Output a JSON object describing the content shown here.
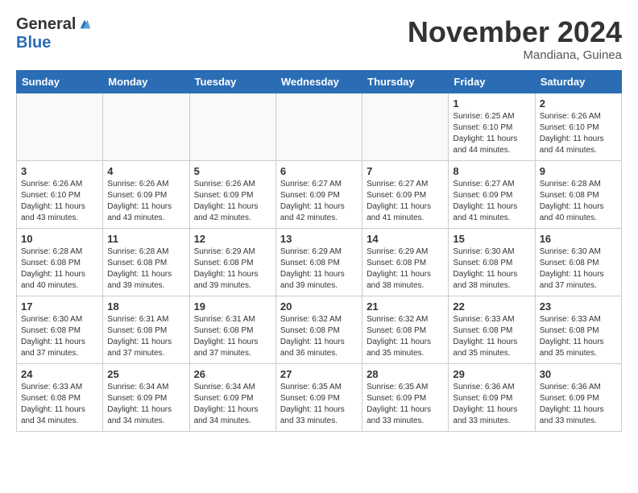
{
  "header": {
    "logo_general": "General",
    "logo_blue": "Blue",
    "month_title": "November 2024",
    "location": "Mandiana, Guinea"
  },
  "days_of_week": [
    "Sunday",
    "Monday",
    "Tuesday",
    "Wednesday",
    "Thursday",
    "Friday",
    "Saturday"
  ],
  "weeks": [
    [
      {
        "day": "",
        "sunrise": "",
        "sunset": "",
        "daylight": "",
        "empty": true
      },
      {
        "day": "",
        "sunrise": "",
        "sunset": "",
        "daylight": "",
        "empty": true
      },
      {
        "day": "",
        "sunrise": "",
        "sunset": "",
        "daylight": "",
        "empty": true
      },
      {
        "day": "",
        "sunrise": "",
        "sunset": "",
        "daylight": "",
        "empty": true
      },
      {
        "day": "",
        "sunrise": "",
        "sunset": "",
        "daylight": "",
        "empty": true
      },
      {
        "day": "1",
        "sunrise": "Sunrise: 6:25 AM",
        "sunset": "Sunset: 6:10 PM",
        "daylight": "Daylight: 11 hours and 44 minutes.",
        "empty": false
      },
      {
        "day": "2",
        "sunrise": "Sunrise: 6:26 AM",
        "sunset": "Sunset: 6:10 PM",
        "daylight": "Daylight: 11 hours and 44 minutes.",
        "empty": false
      }
    ],
    [
      {
        "day": "3",
        "sunrise": "Sunrise: 6:26 AM",
        "sunset": "Sunset: 6:10 PM",
        "daylight": "Daylight: 11 hours and 43 minutes.",
        "empty": false
      },
      {
        "day": "4",
        "sunrise": "Sunrise: 6:26 AM",
        "sunset": "Sunset: 6:09 PM",
        "daylight": "Daylight: 11 hours and 43 minutes.",
        "empty": false
      },
      {
        "day": "5",
        "sunrise": "Sunrise: 6:26 AM",
        "sunset": "Sunset: 6:09 PM",
        "daylight": "Daylight: 11 hours and 42 minutes.",
        "empty": false
      },
      {
        "day": "6",
        "sunrise": "Sunrise: 6:27 AM",
        "sunset": "Sunset: 6:09 PM",
        "daylight": "Daylight: 11 hours and 42 minutes.",
        "empty": false
      },
      {
        "day": "7",
        "sunrise": "Sunrise: 6:27 AM",
        "sunset": "Sunset: 6:09 PM",
        "daylight": "Daylight: 11 hours and 41 minutes.",
        "empty": false
      },
      {
        "day": "8",
        "sunrise": "Sunrise: 6:27 AM",
        "sunset": "Sunset: 6:09 PM",
        "daylight": "Daylight: 11 hours and 41 minutes.",
        "empty": false
      },
      {
        "day": "9",
        "sunrise": "Sunrise: 6:28 AM",
        "sunset": "Sunset: 6:08 PM",
        "daylight": "Daylight: 11 hours and 40 minutes.",
        "empty": false
      }
    ],
    [
      {
        "day": "10",
        "sunrise": "Sunrise: 6:28 AM",
        "sunset": "Sunset: 6:08 PM",
        "daylight": "Daylight: 11 hours and 40 minutes.",
        "empty": false
      },
      {
        "day": "11",
        "sunrise": "Sunrise: 6:28 AM",
        "sunset": "Sunset: 6:08 PM",
        "daylight": "Daylight: 11 hours and 39 minutes.",
        "empty": false
      },
      {
        "day": "12",
        "sunrise": "Sunrise: 6:29 AM",
        "sunset": "Sunset: 6:08 PM",
        "daylight": "Daylight: 11 hours and 39 minutes.",
        "empty": false
      },
      {
        "day": "13",
        "sunrise": "Sunrise: 6:29 AM",
        "sunset": "Sunset: 6:08 PM",
        "daylight": "Daylight: 11 hours and 39 minutes.",
        "empty": false
      },
      {
        "day": "14",
        "sunrise": "Sunrise: 6:29 AM",
        "sunset": "Sunset: 6:08 PM",
        "daylight": "Daylight: 11 hours and 38 minutes.",
        "empty": false
      },
      {
        "day": "15",
        "sunrise": "Sunrise: 6:30 AM",
        "sunset": "Sunset: 6:08 PM",
        "daylight": "Daylight: 11 hours and 38 minutes.",
        "empty": false
      },
      {
        "day": "16",
        "sunrise": "Sunrise: 6:30 AM",
        "sunset": "Sunset: 6:08 PM",
        "daylight": "Daylight: 11 hours and 37 minutes.",
        "empty": false
      }
    ],
    [
      {
        "day": "17",
        "sunrise": "Sunrise: 6:30 AM",
        "sunset": "Sunset: 6:08 PM",
        "daylight": "Daylight: 11 hours and 37 minutes.",
        "empty": false
      },
      {
        "day": "18",
        "sunrise": "Sunrise: 6:31 AM",
        "sunset": "Sunset: 6:08 PM",
        "daylight": "Daylight: 11 hours and 37 minutes.",
        "empty": false
      },
      {
        "day": "19",
        "sunrise": "Sunrise: 6:31 AM",
        "sunset": "Sunset: 6:08 PM",
        "daylight": "Daylight: 11 hours and 37 minutes.",
        "empty": false
      },
      {
        "day": "20",
        "sunrise": "Sunrise: 6:32 AM",
        "sunset": "Sunset: 6:08 PM",
        "daylight": "Daylight: 11 hours and 36 minutes.",
        "empty": false
      },
      {
        "day": "21",
        "sunrise": "Sunrise: 6:32 AM",
        "sunset": "Sunset: 6:08 PM",
        "daylight": "Daylight: 11 hours and 35 minutes.",
        "empty": false
      },
      {
        "day": "22",
        "sunrise": "Sunrise: 6:33 AM",
        "sunset": "Sunset: 6:08 PM",
        "daylight": "Daylight: 11 hours and 35 minutes.",
        "empty": false
      },
      {
        "day": "23",
        "sunrise": "Sunrise: 6:33 AM",
        "sunset": "Sunset: 6:08 PM",
        "daylight": "Daylight: 11 hours and 35 minutes.",
        "empty": false
      }
    ],
    [
      {
        "day": "24",
        "sunrise": "Sunrise: 6:33 AM",
        "sunset": "Sunset: 6:08 PM",
        "daylight": "Daylight: 11 hours and 34 minutes.",
        "empty": false
      },
      {
        "day": "25",
        "sunrise": "Sunrise: 6:34 AM",
        "sunset": "Sunset: 6:09 PM",
        "daylight": "Daylight: 11 hours and 34 minutes.",
        "empty": false
      },
      {
        "day": "26",
        "sunrise": "Sunrise: 6:34 AM",
        "sunset": "Sunset: 6:09 PM",
        "daylight": "Daylight: 11 hours and 34 minutes.",
        "empty": false
      },
      {
        "day": "27",
        "sunrise": "Sunrise: 6:35 AM",
        "sunset": "Sunset: 6:09 PM",
        "daylight": "Daylight: 11 hours and 33 minutes.",
        "empty": false
      },
      {
        "day": "28",
        "sunrise": "Sunrise: 6:35 AM",
        "sunset": "Sunset: 6:09 PM",
        "daylight": "Daylight: 11 hours and 33 minutes.",
        "empty": false
      },
      {
        "day": "29",
        "sunrise": "Sunrise: 6:36 AM",
        "sunset": "Sunset: 6:09 PM",
        "daylight": "Daylight: 11 hours and 33 minutes.",
        "empty": false
      },
      {
        "day": "30",
        "sunrise": "Sunrise: 6:36 AM",
        "sunset": "Sunset: 6:09 PM",
        "daylight": "Daylight: 11 hours and 33 minutes.",
        "empty": false
      }
    ]
  ]
}
